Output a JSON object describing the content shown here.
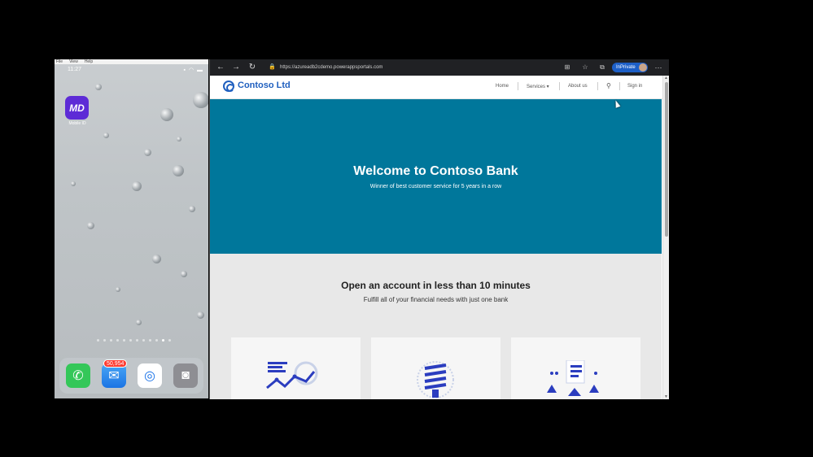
{
  "ipad": {
    "menu": [
      "File",
      "View",
      "Help"
    ],
    "time": "11:27",
    "status_icons": "▪ ◠ ▬",
    "app_label": "Mobile ID",
    "app_initials": "MD",
    "mail_badge": "50,954",
    "dock_icons": [
      "phone-icon",
      "mail-icon",
      "safari-icon",
      "camera-icon"
    ]
  },
  "browser": {
    "url": "https://azureadb2cdemo.powerappsportals.com",
    "inprivate_label": "InPrivate"
  },
  "site": {
    "logo_text": "Contoso Ltd",
    "nav": {
      "home": "Home",
      "services": "Services ▾",
      "about": "About us",
      "signin": "Sign in"
    },
    "hero": {
      "title": "Welcome to Contoso Bank",
      "subtitle": "Winner of best customer service for 5 years in a row"
    },
    "account": {
      "title": "Open an account in less than 10 minutes",
      "subtitle": "Fulfill all of your financial needs with just one bank"
    }
  },
  "colors": {
    "hero_bg": "#00779b",
    "brand": "#1f5fbf",
    "inprivate": "#1d5fc7"
  }
}
